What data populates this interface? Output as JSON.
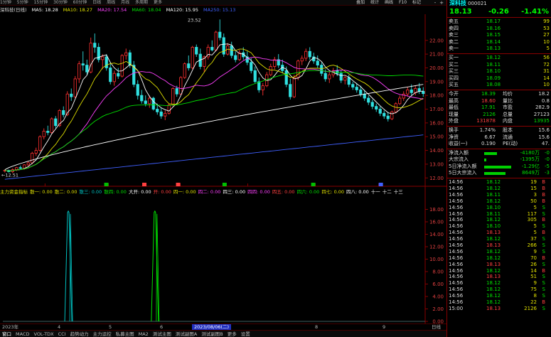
{
  "top_bar": {
    "periods": [
      "1分钟",
      "5分钟",
      "15分钟",
      "30分钟",
      "60分钟",
      "日线",
      "周线",
      "月线",
      "多周期",
      "更多"
    ],
    "right": [
      "叠加",
      "统计",
      "画线",
      "F10",
      "标记",
      "-",
      "+"
    ]
  },
  "chart_header": {
    "name": "深科技(日线)",
    "ma": [
      {
        "label": "MA5: 18.28",
        "color": "#ffffff"
      },
      {
        "label": "MA10: 18.27",
        "color": "#e0e000"
      },
      {
        "label": "MA20: 17.54",
        "color": "#ff40ff"
      },
      {
        "label": "MA60: 18.04",
        "color": "#00e000"
      },
      {
        "label": "MA120: 15.95",
        "color": "#ffffff"
      },
      {
        "label": "MA250: 15.13",
        "color": "#4060ff"
      }
    ]
  },
  "chart_data": [
    {
      "type": "candlestick",
      "title": "深科技(日线)",
      "y_axis_ticks": [
        22.0,
        21.0,
        20.0,
        19.0,
        18.0,
        17.0,
        16.0,
        15.0,
        14.0,
        13.0,
        12.0
      ],
      "ylim": [
        11.6,
        23.9
      ],
      "annotations": [
        "23.52",
        "12.51",
        "←12.51"
      ],
      "x_ticks": [
        "4",
        "5",
        "6",
        "7",
        "8",
        "9"
      ],
      "series": [
        {
          "name": "MA5",
          "color": "#ffffff"
        },
        {
          "name": "MA10",
          "color": "#e0e000"
        },
        {
          "name": "MA20",
          "color": "#ff40ff"
        },
        {
          "name": "MA60",
          "color": "#00e000"
        },
        {
          "name": "MA120",
          "color": "#ffffff"
        },
        {
          "name": "MA250",
          "color": "#4060ff"
        }
      ],
      "candles": [
        [
          12.5,
          12.6,
          12.4,
          12.55
        ],
        [
          12.55,
          12.6,
          12.4,
          12.45
        ],
        [
          12.45,
          12.7,
          12.35,
          12.6
        ],
        [
          12.6,
          12.8,
          12.5,
          12.75
        ],
        [
          12.75,
          12.9,
          12.6,
          12.7
        ],
        [
          12.7,
          13.0,
          12.6,
          12.95
        ],
        [
          12.95,
          13.2,
          12.85,
          13.1
        ],
        [
          13.1,
          13.9,
          13.0,
          13.8
        ],
        [
          13.8,
          14.2,
          13.6,
          14.0
        ],
        [
          14.0,
          15.1,
          13.9,
          15.0
        ],
        [
          15.0,
          15.6,
          14.8,
          15.4
        ],
        [
          15.4,
          15.8,
          15.1,
          15.3
        ],
        [
          15.3,
          16.4,
          15.2,
          16.3
        ],
        [
          16.3,
          16.5,
          15.6,
          15.8
        ],
        [
          15.8,
          17.0,
          15.7,
          16.9
        ],
        [
          16.9,
          17.2,
          16.4,
          16.6
        ],
        [
          16.6,
          18.3,
          16.5,
          18.1
        ],
        [
          18.1,
          18.5,
          17.6,
          17.9
        ],
        [
          17.9,
          19.4,
          17.8,
          19.2
        ],
        [
          19.2,
          20.5,
          18.9,
          20.3
        ],
        [
          20.3,
          21.2,
          19.8,
          20.2
        ],
        [
          20.2,
          20.6,
          19.5,
          19.7
        ],
        [
          19.7,
          22.2,
          19.6,
          21.8
        ],
        [
          21.8,
          22.5,
          21.1,
          21.5
        ],
        [
          21.5,
          21.8,
          20.4,
          20.6
        ],
        [
          20.6,
          21.0,
          19.9,
          20.8
        ],
        [
          20.8,
          21.0,
          19.8,
          20.0
        ],
        [
          20.0,
          20.4,
          18.8,
          19.0
        ],
        [
          19.0,
          19.8,
          18.7,
          19.6
        ],
        [
          19.6,
          20.0,
          19.2,
          19.4
        ],
        [
          19.4,
          21.0,
          19.3,
          20.9
        ],
        [
          20.9,
          21.4,
          20.6,
          21.1
        ],
        [
          21.1,
          21.3,
          20.0,
          20.2
        ],
        [
          20.2,
          20.5,
          18.6,
          18.8
        ],
        [
          18.8,
          19.1,
          17.7,
          18.0
        ],
        [
          18.0,
          18.4,
          17.4,
          17.6
        ],
        [
          17.6,
          18.0,
          17.2,
          17.4
        ],
        [
          17.4,
          18.0,
          17.1,
          17.8
        ],
        [
          17.8,
          17.9,
          16.9,
          17.0
        ],
        [
          17.0,
          17.4,
          16.6,
          16.8
        ],
        [
          16.8,
          17.1,
          16.3,
          16.5
        ],
        [
          16.5,
          16.9,
          16.2,
          16.7
        ],
        [
          16.7,
          17.4,
          16.6,
          17.3
        ],
        [
          17.3,
          18.6,
          17.2,
          18.5
        ],
        [
          18.5,
          18.7,
          17.9,
          18.1
        ],
        [
          18.1,
          19.4,
          18.0,
          19.3
        ],
        [
          19.3,
          20.4,
          19.2,
          20.3
        ],
        [
          20.3,
          20.9,
          19.8,
          20.0
        ],
        [
          20.0,
          21.6,
          19.9,
          21.5
        ],
        [
          21.5,
          21.7,
          20.8,
          21.0
        ],
        [
          21.0,
          21.4,
          19.9,
          20.1
        ],
        [
          20.1,
          20.9,
          19.7,
          20.8
        ],
        [
          20.8,
          21.7,
          20.6,
          21.5
        ],
        [
          21.5,
          22.0,
          21.2,
          21.3
        ],
        [
          21.3,
          22.7,
          21.2,
          22.6
        ],
        [
          22.6,
          23.52,
          22.0,
          22.2
        ],
        [
          22.2,
          22.5,
          20.8,
          21.0
        ],
        [
          21.0,
          21.8,
          20.9,
          21.6
        ],
        [
          21.6,
          21.9,
          20.7,
          20.9
        ],
        [
          20.9,
          21.2,
          20.4,
          20.6
        ],
        [
          20.6,
          21.3,
          20.5,
          21.1
        ],
        [
          21.1,
          21.5,
          20.6,
          20.8
        ],
        [
          20.8,
          21.2,
          20.2,
          20.4
        ],
        [
          20.4,
          20.7,
          19.6,
          19.8
        ],
        [
          19.8,
          20.1,
          18.9,
          19.0
        ],
        [
          19.0,
          19.3,
          18.2,
          18.4
        ],
        [
          18.4,
          18.9,
          18.0,
          18.7
        ],
        [
          18.7,
          19.7,
          18.6,
          19.5
        ],
        [
          19.5,
          20.3,
          19.4,
          20.1
        ],
        [
          20.1,
          20.8,
          19.9,
          20.6
        ],
        [
          20.6,
          21.0,
          20.0,
          20.2
        ],
        [
          20.2,
          20.6,
          19.6,
          19.8
        ],
        [
          19.8,
          20.1,
          18.6,
          18.8
        ],
        [
          18.8,
          19.2,
          17.7,
          17.9
        ],
        [
          17.9,
          19.5,
          17.8,
          19.3
        ],
        [
          19.3,
          20.6,
          19.1,
          20.5
        ],
        [
          20.5,
          20.9,
          20.2,
          20.7
        ],
        [
          20.7,
          21.4,
          20.5,
          21.2
        ],
        [
          21.2,
          21.5,
          20.6,
          20.8
        ],
        [
          20.8,
          21.1,
          20.3,
          20.5
        ],
        [
          20.5,
          20.9,
          20.0,
          20.2
        ],
        [
          20.2,
          20.4,
          19.4,
          19.6
        ],
        [
          19.6,
          19.9,
          19.0,
          19.2
        ],
        [
          19.2,
          19.7,
          18.9,
          19.5
        ],
        [
          19.5,
          20.0,
          19.3,
          19.8
        ],
        [
          19.8,
          20.2,
          19.4,
          19.6
        ],
        [
          19.6,
          19.8,
          18.9,
          19.1
        ],
        [
          19.1,
          19.4,
          18.8,
          19.3
        ],
        [
          19.3,
          19.5,
          18.6,
          18.8
        ],
        [
          18.8,
          19.0,
          18.4,
          18.6
        ],
        [
          18.6,
          18.9,
          18.2,
          18.4
        ],
        [
          18.4,
          18.7,
          17.9,
          18.1
        ],
        [
          18.1,
          18.4,
          17.6,
          17.8
        ],
        [
          17.8,
          18.0,
          17.3,
          17.5
        ],
        [
          17.5,
          17.7,
          17.0,
          17.2
        ],
        [
          17.2,
          17.4,
          16.8,
          17.0
        ],
        [
          17.0,
          17.2,
          16.5,
          16.7
        ],
        [
          16.7,
          16.9,
          16.3,
          16.5
        ],
        [
          16.5,
          16.8,
          16.1,
          16.3
        ],
        [
          16.3,
          16.9,
          16.2,
          16.8
        ],
        [
          16.8,
          17.5,
          16.7,
          17.4
        ],
        [
          17.4,
          18.0,
          17.3,
          17.8
        ],
        [
          17.8,
          18.3,
          17.6,
          18.1
        ],
        [
          18.1,
          18.6,
          17.9,
          18.4
        ],
        [
          18.4,
          18.8,
          18.0,
          18.2
        ],
        [
          18.2,
          18.7,
          18.0,
          18.5
        ],
        [
          18.5,
          18.9,
          18.1,
          18.3
        ],
        [
          18.3,
          18.6,
          17.9,
          18.13
        ]
      ]
    },
    {
      "type": "line",
      "title": "主力资金指标",
      "series": [
        {
          "name": "散一",
          "color": "#00c0c0",
          "spike_at": 0.155
        },
        {
          "name": "散二",
          "color": "#00e000",
          "spike_at": 0.36
        }
      ],
      "ylim": [
        0,
        20
      ],
      "y_axis_ticks": [
        18.0,
        16.0,
        14.0,
        12.0,
        10.0,
        8.0,
        6.0,
        4.0,
        2.0,
        0.0
      ]
    }
  ],
  "indicator_line": {
    "items": [
      {
        "t": "主力资金指标",
        "c": "#e0e000"
      },
      {
        "t": "散一: 0.00",
        "c": "#e0e000"
      },
      {
        "t": "散二: 0.00",
        "c": "#e0e000"
      },
      {
        "t": "散三: 0.00",
        "c": "#00c0c0"
      },
      {
        "t": "散四: 0.00",
        "c": "#00e000"
      },
      {
        "t": "大开: 0.00",
        "c": "#ffffff"
      },
      {
        "t": "开: 0.00",
        "c": "#ff4040"
      },
      {
        "t": "四一: 0.00",
        "c": "#e0e000"
      },
      {
        "t": "四二: 0.00",
        "c": "#ff40ff"
      },
      {
        "t": "四三: 0.00",
        "c": "#ffffff"
      },
      {
        "t": "四四: 0.00",
        "c": "#ff40ff"
      },
      {
        "t": "四五: 0.00",
        "c": "#ff4040"
      },
      {
        "t": "四六: 0.00",
        "c": "#00e000"
      },
      {
        "t": "四七: 0.00",
        "c": "#e0e000"
      },
      {
        "t": "四八: 0.00",
        "c": "#ffffff"
      },
      {
        "t": "十一",
        "c": "#ffffff"
      },
      {
        "t": "十二",
        "c": "#ffffff"
      },
      {
        "t": "十三",
        "c": "#ffffff"
      }
    ]
  },
  "bottom_bar": {
    "x_labels": [
      "2023年",
      "4",
      "5",
      "6",
      "7",
      "8",
      "9"
    ],
    "date_box": "2023/08/06(二)",
    "right": "日线"
  },
  "tabs": [
    "窗口",
    "MACD",
    "VOL-TDX",
    "CCI",
    "趋势动力",
    "主力运控",
    "私募主图",
    "MA2",
    "测试主图",
    "测试副图A",
    "测试副图B",
    "更多",
    "设置"
  ],
  "right_panel": {
    "name": "深科技",
    "code": "000021",
    "price": "18.13",
    "change": "-0.26",
    "pct": "-1.41%",
    "asks": [
      {
        "l": "卖五",
        "p": "18.17",
        "v": "99"
      },
      {
        "l": "卖四",
        "p": "18.16",
        "v": "53"
      },
      {
        "l": "卖三",
        "p": "18.15",
        "v": "27"
      },
      {
        "l": "卖二",
        "p": "18.14",
        "v": "10"
      },
      {
        "l": "卖一",
        "p": "18.13",
        "v": "5"
      }
    ],
    "bids": [
      {
        "l": "买一",
        "p": "18.12",
        "v": "56"
      },
      {
        "l": "买二",
        "p": "18.11",
        "v": "72"
      },
      {
        "l": "买三",
        "p": "18.10",
        "v": "31"
      },
      {
        "l": "买四",
        "p": "18.09",
        "v": "14"
      },
      {
        "l": "买五",
        "p": "18.08",
        "v": "10"
      }
    ],
    "stats": [
      [
        "今开",
        "18.39",
        "均价",
        "18.2"
      ],
      [
        "最高",
        "18.60",
        "量比",
        "0.8"
      ],
      [
        "最低",
        "17.91",
        "市盈",
        "282.9"
      ],
      [
        "现量",
        "2126",
        "总量",
        "27123"
      ],
      [
        "外盘",
        "131878",
        "内盘",
        "13935"
      ]
    ],
    "stats2": [
      [
        "换手",
        "1.74%",
        "股本",
        "15.6"
      ],
      [
        "净资",
        "6.67",
        "流通",
        "15.6"
      ],
      [
        "收益(一)",
        "0.190",
        "PE(动)",
        "47."
      ]
    ],
    "flows": [
      {
        "l": "净流入额",
        "v": "-4180万",
        "r": "-0",
        "w": 0.35
      },
      {
        "l": "大宗流入",
        "v": "-1395万",
        "r": "-0",
        "w": 0.05
      },
      {
        "l": "5日净流入额",
        "v": "-1.29亿",
        "r": "-5",
        "w": 0.75
      },
      {
        "l": "5日大宗流入",
        "v": "8649万",
        "r": "-3",
        "w": 0.6
      }
    ],
    "ticks": [
      [
        "14:56",
        "18.12",
        "19",
        "B"
      ],
      [
        "14:56",
        "18.12",
        "15",
        "B"
      ],
      [
        "14:56",
        "18.11",
        "3",
        "B"
      ],
      [
        "14:56",
        "18.12",
        "50",
        "B"
      ],
      [
        "14:56",
        "18.10",
        "5",
        "S"
      ],
      [
        "14:56",
        "18.11",
        "117",
        "S"
      ],
      [
        "14:56",
        "18.12",
        "305",
        "B"
      ],
      [
        "14:56",
        "18.10",
        "5",
        "S"
      ],
      [
        "14:56",
        "18.13",
        "5",
        "B"
      ],
      [
        "14:56",
        "18.12",
        "37",
        "S"
      ],
      [
        "14:56",
        "18.13",
        "266",
        "S"
      ],
      [
        "14:56",
        "18.12",
        "9",
        "S"
      ],
      [
        "14:56",
        "18.12",
        "70",
        "B"
      ],
      [
        "14:56",
        "18.13",
        "26",
        "S"
      ],
      [
        "14:56",
        "18.12",
        "14",
        "B"
      ],
      [
        "14:56",
        "18.13",
        "51",
        "S"
      ],
      [
        "14:56",
        "18.12",
        "9",
        "S"
      ],
      [
        "14:56",
        "18.12",
        "75",
        "S"
      ],
      [
        "14:56",
        "18.12",
        "8",
        "S"
      ],
      [
        "14:56",
        "18.12",
        "22",
        "B"
      ],
      [
        "15:00",
        "18.13",
        "2126",
        "S"
      ]
    ]
  }
}
